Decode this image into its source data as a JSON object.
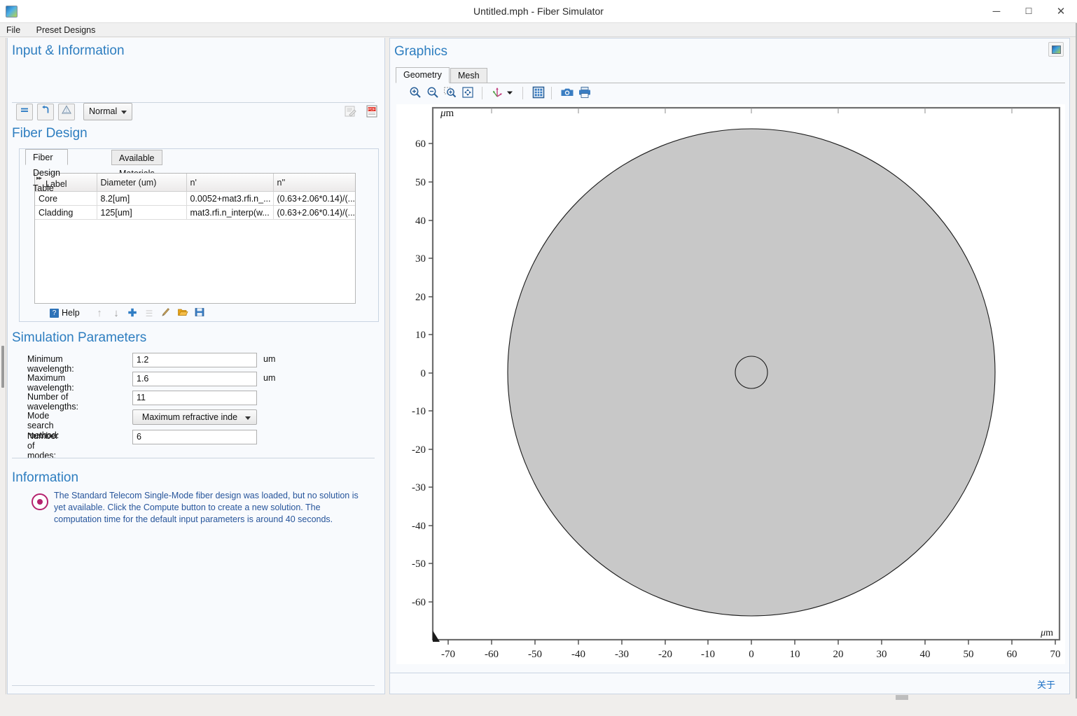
{
  "window": {
    "title": "Untitled.mph - Fiber Simulator",
    "app_icon": "app-logo-icon",
    "minimize": "─",
    "maximize": "☐",
    "close": "✕"
  },
  "menubar": {
    "items": [
      {
        "label": "File"
      },
      {
        "label": "Preset Designs"
      }
    ]
  },
  "left_panel": {
    "input_information": {
      "title": "Input & Information",
      "toolbar": [
        {
          "name": "compute-button",
          "glyph": "="
        },
        {
          "name": "reset-button",
          "glyph": "↩"
        },
        {
          "name": "warning-button",
          "glyph": "⚠"
        },
        {
          "name": "report-button",
          "glyph": "☰"
        },
        {
          "name": "pdf-button",
          "glyph": "PDF"
        }
      ],
      "quality_select": {
        "value": "Normal",
        "options": [
          "Normal"
        ]
      }
    },
    "fiber_design": {
      "title": "Fiber Design",
      "tabs": [
        {
          "label": "Fiber Design Table",
          "active": true
        },
        {
          "label": "Available Materials",
          "active": false
        }
      ],
      "table": {
        "corner_icon": "expand-all-icon",
        "columns": [
          "Label",
          "Diameter (um)",
          "n'",
          "n''"
        ],
        "rows": [
          [
            "Core",
            "8.2[um]",
            "0.0052+mat3.rfi.n_...",
            "(0.63+2.06*0.14)/(..."
          ],
          [
            "Cladding",
            "125[um]",
            "mat3.rfi.n_interp(w...",
            "(0.63+2.06*0.14)/(..."
          ]
        ]
      },
      "table_toolbar": {
        "help_badge": "?",
        "help_label": "Help",
        "buttons": [
          {
            "name": "move-up-button",
            "glyph": "↑"
          },
          {
            "name": "move-down-button",
            "glyph": "↓"
          },
          {
            "name": "add-row-button",
            "glyph": "✚"
          },
          {
            "name": "delete-row-button",
            "glyph": "☰"
          },
          {
            "name": "clear-table-button",
            "glyph": "✒"
          },
          {
            "name": "load-from-file-button",
            "glyph": "📁"
          },
          {
            "name": "save-to-file-button",
            "glyph": "💾"
          }
        ]
      }
    },
    "simulation_parameters": {
      "title": "Simulation Parameters",
      "fields": [
        {
          "label": "Minimum wavelength:",
          "value": "1.2",
          "unit": "um",
          "type": "text"
        },
        {
          "label": "Maximum wavelength:",
          "value": "1.6",
          "unit": "um",
          "type": "text"
        },
        {
          "label": "Number of wavelengths:",
          "value": "11",
          "unit": "",
          "type": "text"
        },
        {
          "label": "Mode search method:",
          "value": "Maximum refractive inde",
          "unit": "",
          "type": "select"
        },
        {
          "label": "Number of modes:",
          "value": "6",
          "unit": "",
          "type": "text"
        }
      ]
    },
    "information": {
      "title": "Information",
      "icon": "info-status-icon",
      "message": "The Standard Telecom Single-Mode fiber design was loaded, but no solution is yet available. Click the Compute button to create a new solution. The computation time for the default input parameters is around 40 seconds."
    }
  },
  "right_panel": {
    "title": "Graphics",
    "window_button": "graphics-window-icon",
    "tabs": [
      {
        "label": "Geometry",
        "active": true
      },
      {
        "label": "Mesh",
        "active": false
      }
    ],
    "toolbar": [
      {
        "name": "zoom-in-icon",
        "glyph": "zoom-in"
      },
      {
        "name": "zoom-out-icon",
        "glyph": "zoom-out"
      },
      {
        "name": "zoom-box-icon",
        "glyph": "zoom-box"
      },
      {
        "name": "zoom-extents-icon",
        "glyph": "zoom-extents"
      },
      {
        "name": "axis-orientation-icon",
        "glyph": "axes"
      },
      {
        "name": "axis-dropdown-caret-icon",
        "glyph": "caret"
      },
      {
        "name": "grid-toggle-icon",
        "glyph": "grid"
      },
      {
        "name": "snapshot-icon",
        "glyph": "camera"
      },
      {
        "name": "print-icon",
        "glyph": "printer"
      }
    ],
    "status_about_link": "关于"
  },
  "chart_data": {
    "type": "scatter",
    "title": "",
    "xlabel": "μm",
    "ylabel": "μm",
    "xlim": [
      -78,
      78
    ],
    "ylim": [
      -68,
      68
    ],
    "xticks": [
      -70,
      -60,
      -50,
      -40,
      -30,
      -20,
      -10,
      0,
      10,
      20,
      30,
      40,
      50,
      60,
      70
    ],
    "yticks": [
      60,
      50,
      40,
      30,
      20,
      10,
      0,
      -10,
      -20,
      -30,
      -40,
      -50,
      -60
    ],
    "grid": false,
    "legend": "none",
    "shapes": [
      {
        "name": "Cladding",
        "kind": "circle",
        "cx": 0,
        "cy": 0,
        "diameter_um": 125,
        "fill": "#c8c8c8",
        "stroke": "#1a1a1a"
      },
      {
        "name": "Core",
        "kind": "circle",
        "cx": 0,
        "cy": 0,
        "diameter_um": 8.2,
        "fill": "#c8c8c8",
        "stroke": "#1a1a1a"
      }
    ]
  },
  "colors": {
    "accent_blue": "#2e7ec0",
    "info_magenta": "#b5216e",
    "info_text": "#27559b",
    "link_blue": "#1b6fc4",
    "geometry_fill": "#c8c8c8"
  }
}
